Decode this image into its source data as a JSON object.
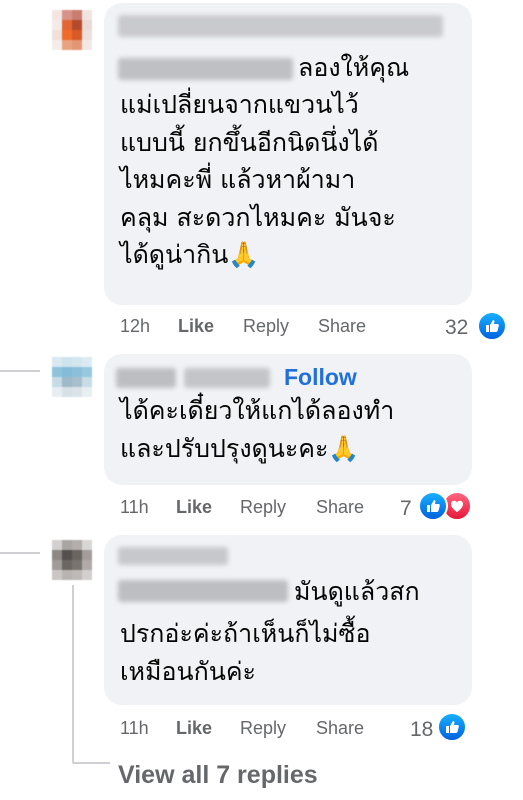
{
  "comments": [
    {
      "text_line1": "ลองให้คุณ",
      "text_rest": "แม่เปลี่ยนจากแขวนไว้\nแบบนี้ ยกขึ้นอีกนิดนึ่งได้\nไหมคะพี่ แล้วหาผ้ามา\nคลุม สะดวกไหมคะ มันจะ\nได้ดูน่ากิน🙏",
      "time": "12h",
      "like_label": "Like",
      "reply_label": "Reply",
      "share_label": "Share",
      "reaction_count": "32",
      "reactions": [
        "like-icon"
      ]
    },
    {
      "follow_label": "Follow",
      "text_rest": "ได้คะเดี๋ยวให้แกได้ลองทำ\nและปรับปรุงดูนะคะ🙏",
      "time": "11h",
      "like_label": "Like",
      "reply_label": "Reply",
      "share_label": "Share",
      "reaction_count": "7",
      "reactions": [
        "like-icon",
        "love-icon"
      ]
    },
    {
      "text_line1": "มันดูแล้วสก",
      "text_rest": "ปรกอ่ะค่ะถ้าเห็นก็ไม่ซื้อ\nเหมือนกันค่ะ",
      "time": "11h",
      "like_label": "Like",
      "reply_label": "Reply",
      "share_label": "Share",
      "reaction_count": "18",
      "reactions": [
        "like-icon"
      ]
    }
  ],
  "view_replies_label": "View all 7 replies",
  "colors": {
    "bubble": "#f0f2f5",
    "link": "#216fdb",
    "meta": "#65676b",
    "like": "#0a7cff",
    "love": "#f33e58"
  }
}
